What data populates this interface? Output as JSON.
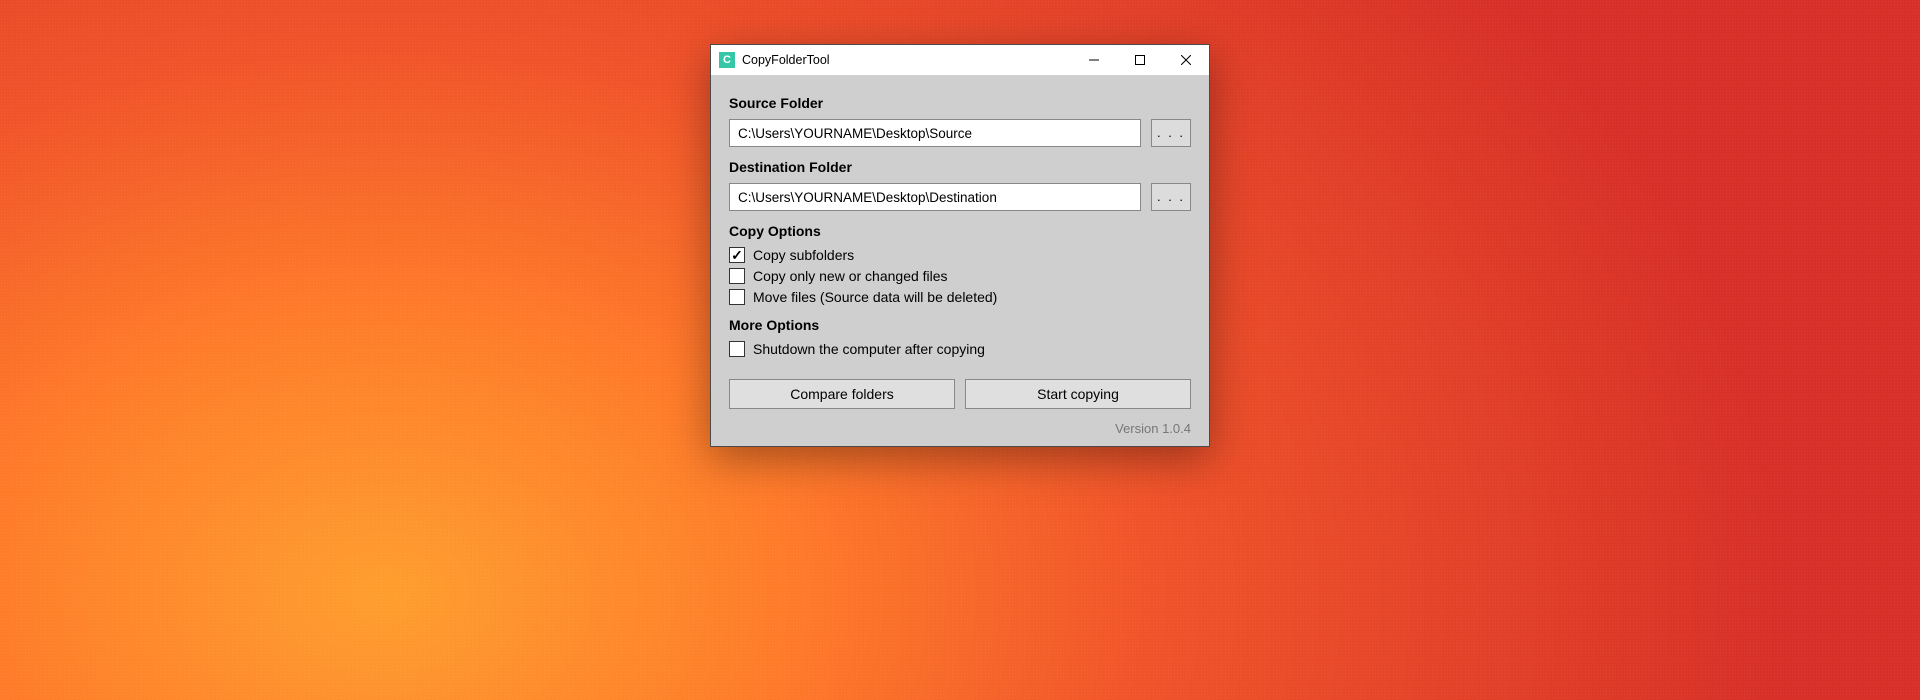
{
  "window": {
    "title": "CopyFolderTool",
    "app_icon_letter": "C"
  },
  "source": {
    "label": "Source Folder",
    "value": "C:\\Users\\YOURNAME\\Desktop\\Source",
    "browse": ". . ."
  },
  "destination": {
    "label": "Destination Folder",
    "value": "C:\\Users\\YOURNAME\\Desktop\\Destination",
    "browse": ". . ."
  },
  "copy_options": {
    "heading": "Copy Options",
    "subfolders": {
      "label": "Copy subfolders",
      "checked": true
    },
    "new_changed": {
      "label": "Copy only new or changed files",
      "checked": false
    },
    "move_files": {
      "label": "Move files (Source data will be deleted)",
      "checked": false
    }
  },
  "more_options": {
    "heading": "More Options",
    "shutdown": {
      "label": "Shutdown the computer after copying",
      "checked": false
    }
  },
  "buttons": {
    "compare": "Compare folders",
    "start": "Start copying"
  },
  "version": "Version 1.0.4"
}
